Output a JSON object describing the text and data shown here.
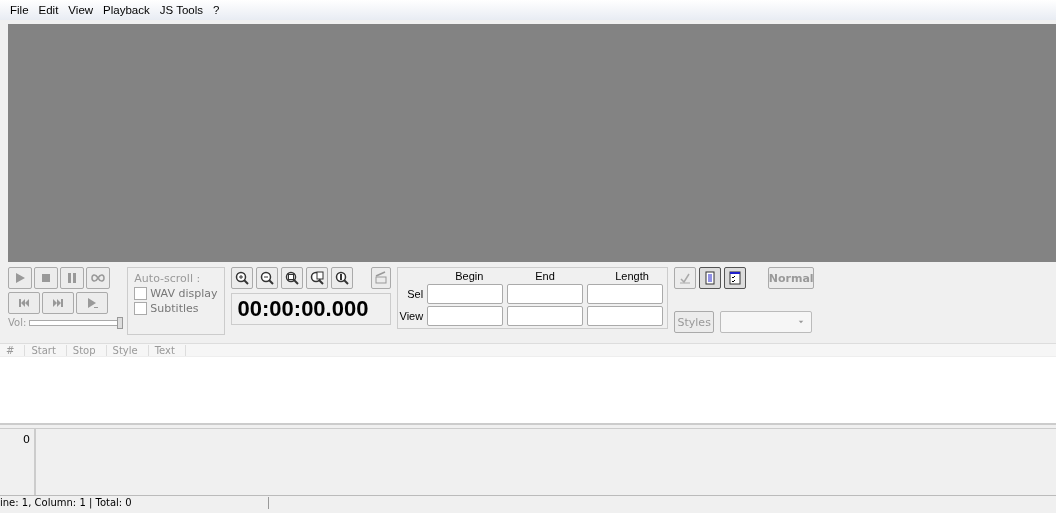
{
  "menu": [
    "File",
    "Edit",
    "View",
    "Playback",
    "JS Tools",
    "?"
  ],
  "volume": {
    "label": "Vol:",
    "level": 1
  },
  "autoscroll": {
    "title": "Auto-scroll :",
    "options": [
      {
        "label": "WAV display",
        "checked": false
      },
      {
        "label": "Subtitles",
        "checked": false
      }
    ]
  },
  "time": "00:00:00.000",
  "range": {
    "columns": [
      "Begin",
      "End",
      "Length"
    ],
    "rows": [
      "Sel",
      "View"
    ]
  },
  "normal_button": "Normal",
  "styles_button": "Styles",
  "list": {
    "columns": [
      "#",
      "Start",
      "Stop",
      "Style",
      "Text"
    ]
  },
  "editor": {
    "line_number": "0"
  },
  "status_bar": "ine: 1, Column: 1 | Total: 0"
}
